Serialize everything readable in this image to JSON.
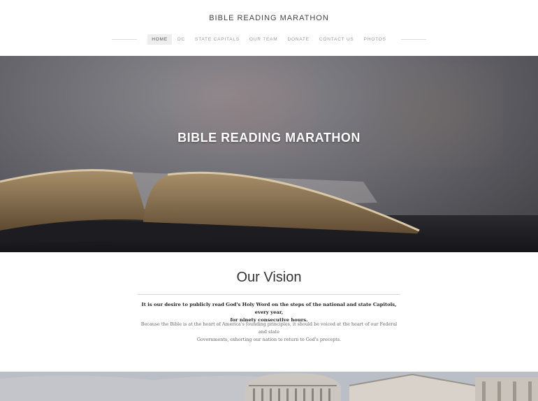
{
  "site": {
    "title": "BIBLE READING MARATHON"
  },
  "nav": {
    "items": [
      {
        "label": "HOME",
        "active": true
      },
      {
        "label": "DC"
      },
      {
        "label": "STATE CAPITALS"
      },
      {
        "label": "OUR TEAM"
      },
      {
        "label": "DONATE"
      },
      {
        "label": "CONTACT US"
      },
      {
        "label": "PHOTOS"
      }
    ]
  },
  "hero": {
    "title": "BIBLE READING MARATHON"
  },
  "vision": {
    "title": "Our Vision",
    "lead_line1": "It is our desire to publicly read God's Holy Word on the steps of the national and state Capitols, every year,",
    "lead_line2": "for ninety consecutive hours.",
    "body_line1": "Because the Bible is at the heart of America's founding principles, it should be voiced at the heart of our Federal and state",
    "body_line2": "Governments, exhorting our nation to return to God's precepts."
  },
  "colors": {
    "nav_active_bg": "#eeeeee",
    "hero_title": "#ffffff",
    "accent_dark": "#333333"
  }
}
